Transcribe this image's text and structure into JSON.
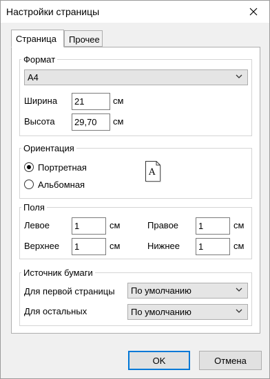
{
  "window": {
    "title": "Настройки страницы"
  },
  "tabs": [
    {
      "label": "Страница",
      "active": true
    },
    {
      "label": "Прочее",
      "active": false
    }
  ],
  "format": {
    "group_title": "Формат",
    "paper_size": "A4",
    "width_label": "Ширина",
    "width_value": "21",
    "height_label": "Высота",
    "height_value": "29,70",
    "unit": "см"
  },
  "orientation": {
    "group_title": "Ориентация",
    "portrait_label": "Портретная",
    "landscape_label": "Альбомная",
    "selected": "portrait",
    "icon_letter": "A"
  },
  "margins": {
    "group_title": "Поля",
    "left_label": "Левое",
    "left_value": "1",
    "right_label": "Правое",
    "right_value": "1",
    "top_label": "Верхнее",
    "top_value": "1",
    "bottom_label": "Нижнее",
    "bottom_value": "1",
    "unit": "см"
  },
  "paper_source": {
    "group_title": "Источник бумаги",
    "first_page_label": "Для первой страницы",
    "first_page_value": "По умолчанию",
    "other_pages_label": "Для остальных",
    "other_pages_value": "По умолчанию"
  },
  "buttons": {
    "ok": "OK",
    "cancel": "Отмена"
  },
  "colors": {
    "accent": "#0078d7"
  }
}
